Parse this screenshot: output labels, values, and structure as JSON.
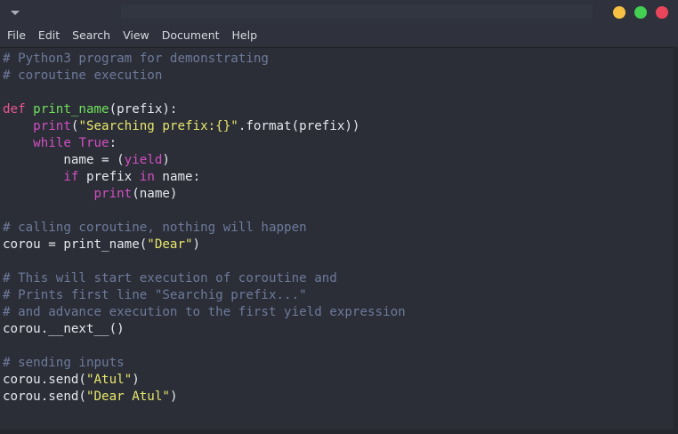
{
  "menu": {
    "items": [
      "File",
      "Edit",
      "Search",
      "View",
      "Document",
      "Help"
    ]
  },
  "colors": {
    "close": "#e9465b",
    "maximize": "#42cf52",
    "minimize": "#f6c042",
    "comment": "#6d7a9a",
    "keyword": "#d14fc1",
    "string": "#e8e76c",
    "function": "#6fe05a"
  },
  "code": {
    "lines": [
      [
        {
          "t": "comment",
          "v": "# Python3 program for demonstrating"
        }
      ],
      [
        {
          "t": "comment",
          "v": "# coroutine execution"
        }
      ],
      [],
      [
        {
          "t": "def",
          "v": "def "
        },
        {
          "t": "funcname",
          "v": "print_name"
        },
        {
          "t": "plain",
          "v": "(prefix):"
        }
      ],
      [
        {
          "t": "plain",
          "v": "    "
        },
        {
          "t": "builtin",
          "v": "print"
        },
        {
          "t": "plain",
          "v": "("
        },
        {
          "t": "string",
          "v": "\"Searching prefix:{}\""
        },
        {
          "t": "plain",
          "v": ".format(prefix))"
        }
      ],
      [
        {
          "t": "plain",
          "v": "    "
        },
        {
          "t": "keyword",
          "v": "while"
        },
        {
          "t": "plain",
          "v": " "
        },
        {
          "t": "keyword",
          "v": "True"
        },
        {
          "t": "plain",
          "v": ":"
        }
      ],
      [
        {
          "t": "plain",
          "v": "        name = ("
        },
        {
          "t": "keyword",
          "v": "yield"
        },
        {
          "t": "plain",
          "v": ")"
        }
      ],
      [
        {
          "t": "plain",
          "v": "        "
        },
        {
          "t": "keyword",
          "v": "if"
        },
        {
          "t": "plain",
          "v": " prefix "
        },
        {
          "t": "keyword",
          "v": "in"
        },
        {
          "t": "plain",
          "v": " name:"
        }
      ],
      [
        {
          "t": "plain",
          "v": "            "
        },
        {
          "t": "builtin",
          "v": "print"
        },
        {
          "t": "plain",
          "v": "(name)"
        }
      ],
      [],
      [
        {
          "t": "comment",
          "v": "# calling coroutine, nothing will happen"
        }
      ],
      [
        {
          "t": "plain",
          "v": "corou = print_name("
        },
        {
          "t": "string",
          "v": "\"Dear\""
        },
        {
          "t": "plain",
          "v": ")"
        }
      ],
      [],
      [
        {
          "t": "comment",
          "v": "# This will start execution of coroutine and"
        }
      ],
      [
        {
          "t": "comment",
          "v": "# Prints first line \"Searchig prefix...\""
        }
      ],
      [
        {
          "t": "comment",
          "v": "# and advance execution to the first yield expression"
        }
      ],
      [
        {
          "t": "plain",
          "v": "corou.__next__()"
        }
      ],
      [],
      [
        {
          "t": "comment",
          "v": "# sending inputs"
        }
      ],
      [
        {
          "t": "plain",
          "v": "corou.send("
        },
        {
          "t": "string",
          "v": "\"Atul\""
        },
        {
          "t": "plain",
          "v": ")"
        }
      ],
      [
        {
          "t": "plain",
          "v": "corou.send("
        },
        {
          "t": "string",
          "v": "\"Dear Atul\""
        },
        {
          "t": "plain",
          "v": ")"
        }
      ]
    ]
  }
}
